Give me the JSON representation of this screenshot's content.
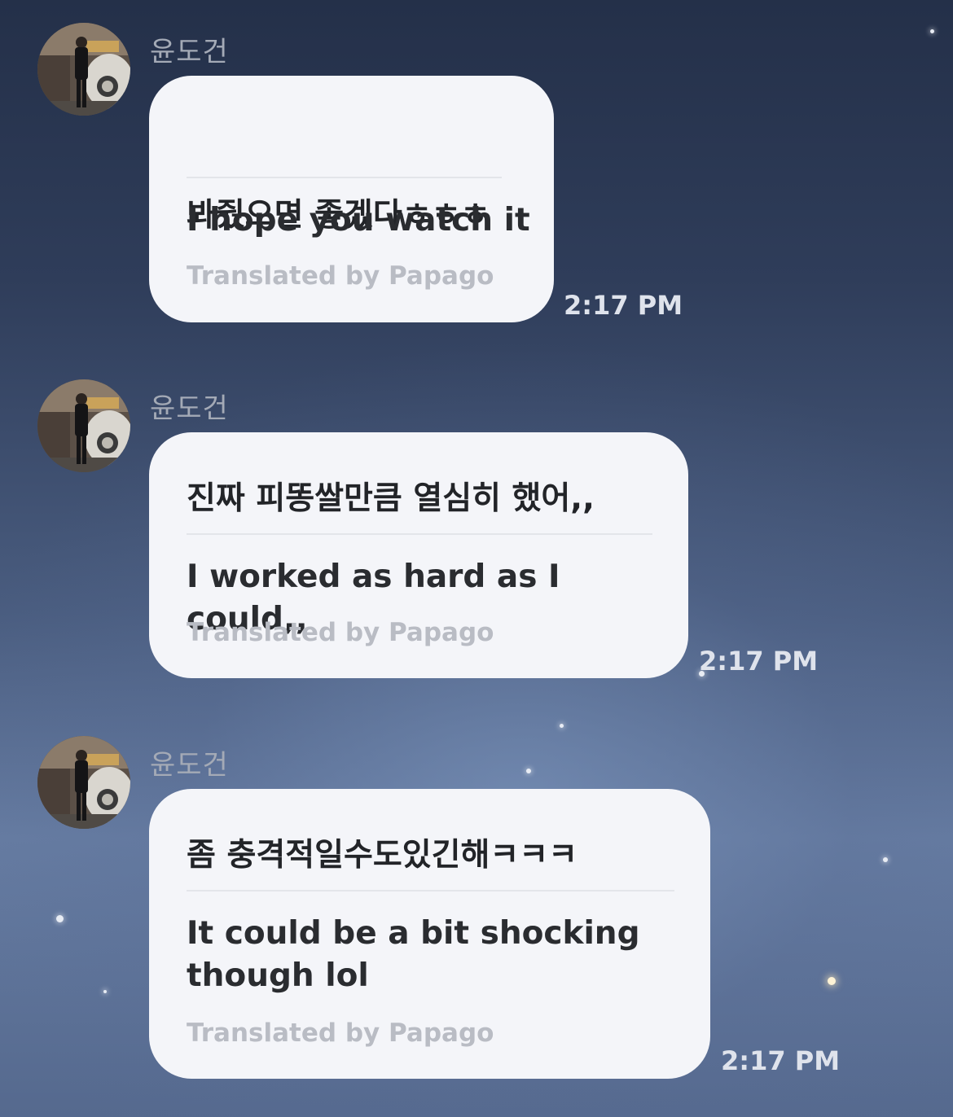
{
  "messages": [
    {
      "sender": "윤도건",
      "korean": "봐줬으면 좋겠다ㅎㅎㅎ",
      "translation": "I hope you watch it",
      "credit": "Translated by Papago",
      "time": "2:17 PM"
    },
    {
      "sender": "윤도건",
      "korean": "진짜 피똥쌀만큼 열심히 했어,,",
      "translation": "I worked as hard as I could,,",
      "credit": "Translated by Papago",
      "time": "2:17 PM"
    },
    {
      "sender": "윤도건",
      "korean": "좀 충격적일수도있긴해ㅋㅋㅋ",
      "translation": "It could be a bit shocking though lol",
      "credit": "Translated by Papago",
      "time": "2:17 PM"
    }
  ],
  "colors": {
    "bubble": "#f4f5f9",
    "sender": "#a4aab6",
    "credit": "#b9bcc4",
    "time": "#dfe3ec"
  }
}
